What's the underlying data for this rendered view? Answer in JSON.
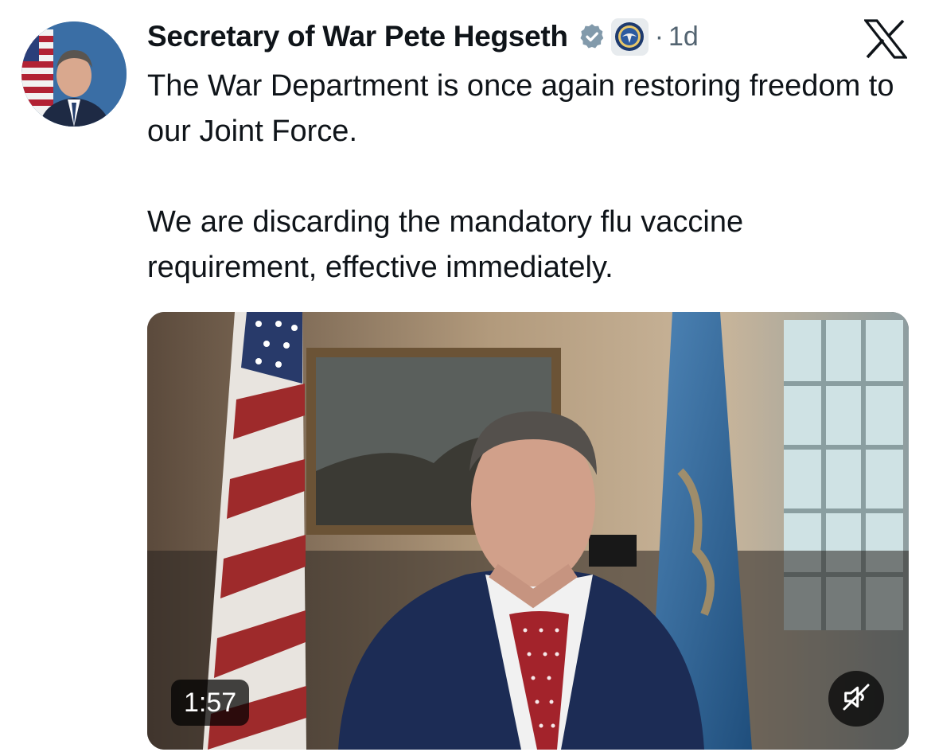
{
  "post": {
    "author": {
      "display_name": "Secretary of War Pete Hegseth",
      "verified_badge_icon": "verified-badge-icon",
      "affiliation_icon": "department-seal-icon"
    },
    "separator": "·",
    "timestamp": "1d",
    "platform_icon": "x-logo-icon",
    "text_paragraphs": [
      "The War Department is once again restoring freedom to our Joint Force.",
      "We are discarding the mandatory flu vaccine requirement, effective immediately."
    ],
    "video": {
      "duration": "1:57",
      "mute_icon": "speaker-muted-icon"
    }
  },
  "colors": {
    "text_primary": "#0f1419",
    "text_secondary": "#536471",
    "verified_badge": "#829aab",
    "overlay": "rgba(0,0,0,0.72)"
  }
}
